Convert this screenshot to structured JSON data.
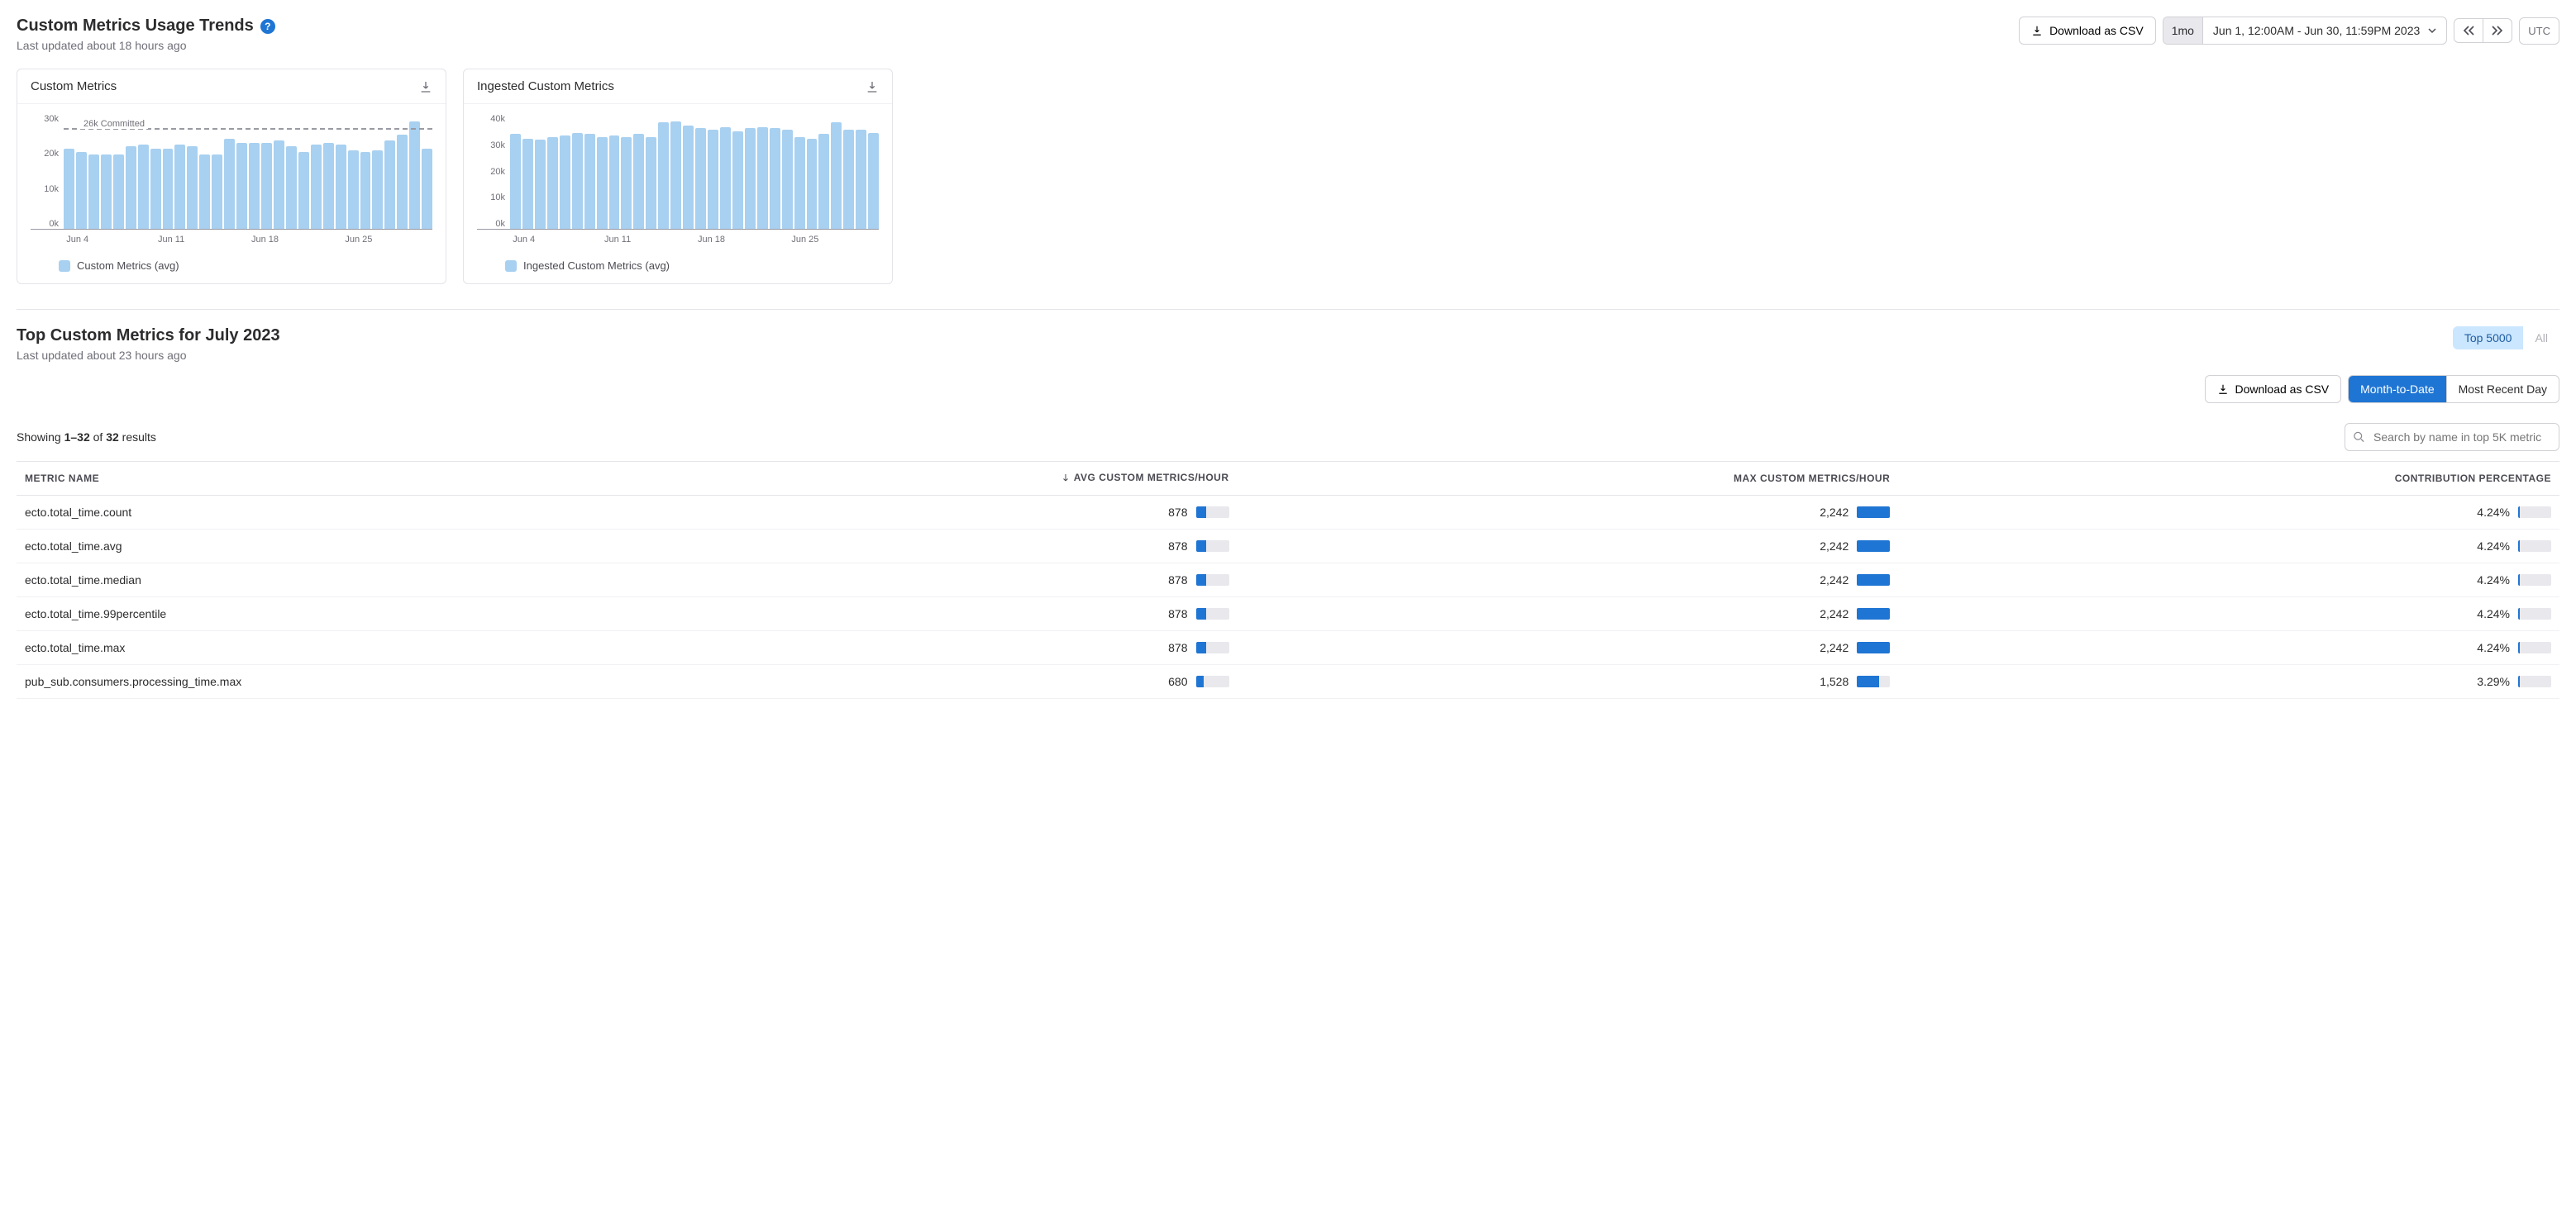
{
  "trends": {
    "title": "Custom Metrics Usage Trends",
    "subtitle": "Last updated about 18 hours ago",
    "download_csv": "Download as CSV",
    "range_chip": "1mo",
    "range_text": "Jun 1, 12:00AM - Jun 30, 11:59PM 2023",
    "tz": "UTC"
  },
  "chart_data": [
    {
      "type": "bar",
      "title": "Custom Metrics",
      "legend": "Custom Metrics (avg)",
      "ylim": [
        0,
        30000
      ],
      "yticks": [
        "0k",
        "10k",
        "20k",
        "30k"
      ],
      "annotation": "26k Committed",
      "annotation_value": 26000,
      "xticks": [
        "Jun 4",
        "Jun 11",
        "Jun 18",
        "Jun 25"
      ],
      "categories": [
        "Jun 1",
        "Jun 2",
        "Jun 3",
        "Jun 4",
        "Jun 5",
        "Jun 6",
        "Jun 7",
        "Jun 8",
        "Jun 9",
        "Jun 10",
        "Jun 11",
        "Jun 12",
        "Jun 13",
        "Jun 14",
        "Jun 15",
        "Jun 16",
        "Jun 17",
        "Jun 18",
        "Jun 19",
        "Jun 20",
        "Jun 21",
        "Jun 22",
        "Jun 23",
        "Jun 24",
        "Jun 25",
        "Jun 26",
        "Jun 27",
        "Jun 28",
        "Jun 29",
        "Jun 30"
      ],
      "values": [
        21000,
        20000,
        19500,
        19500,
        19500,
        21500,
        22000,
        21000,
        21000,
        22000,
        21500,
        19500,
        19500,
        23500,
        22500,
        22500,
        22500,
        23000,
        21500,
        20000,
        22000,
        22500,
        22000,
        20500,
        20000,
        20500,
        23000,
        24500,
        28000,
        21000
      ]
    },
    {
      "type": "bar",
      "title": "Ingested Custom Metrics",
      "legend": "Ingested Custom Metrics (avg)",
      "ylim": [
        0,
        40000
      ],
      "yticks": [
        "0k",
        "10k",
        "20k",
        "30k",
        "40k"
      ],
      "xticks": [
        "Jun 4",
        "Jun 11",
        "Jun 18",
        "Jun 25"
      ],
      "categories": [
        "Jun 1",
        "Jun 2",
        "Jun 3",
        "Jun 4",
        "Jun 5",
        "Jun 6",
        "Jun 7",
        "Jun 8",
        "Jun 9",
        "Jun 10",
        "Jun 11",
        "Jun 12",
        "Jun 13",
        "Jun 14",
        "Jun 15",
        "Jun 16",
        "Jun 17",
        "Jun 18",
        "Jun 19",
        "Jun 20",
        "Jun 21",
        "Jun 22",
        "Jun 23",
        "Jun 24",
        "Jun 25",
        "Jun 26",
        "Jun 27",
        "Jun 28",
        "Jun 29",
        "Jun 30"
      ],
      "values": [
        33000,
        31500,
        31000,
        32000,
        32500,
        33500,
        33000,
        32000,
        32500,
        32000,
        33000,
        32000,
        37000,
        37500,
        36000,
        35000,
        34500,
        35500,
        34000,
        35000,
        35500,
        35000,
        34500,
        32000,
        31500,
        33000,
        37000,
        34500,
        34500,
        33500
      ]
    }
  ],
  "top": {
    "title": "Top Custom Metrics for July 2023",
    "subtitle": "Last updated about 23 hours ago",
    "top5000": "Top 5000",
    "all": "All",
    "download_csv": "Download as CSV",
    "mtd": "Month-to-Date",
    "most_recent": "Most Recent Day",
    "showing_prefix": "Showing ",
    "showing_range": "1–32",
    "showing_mid": " of ",
    "showing_total": "32",
    "showing_suffix": " results",
    "search_placeholder": "Search by name in top 5K metric",
    "columns": {
      "name": "METRIC NAME",
      "avg": "AVG CUSTOM METRICS/HOUR",
      "max": "MAX CUSTOM METRICS/HOUR",
      "contrib": "CONTRIBUTION PERCENTAGE"
    },
    "rows": [
      {
        "name": "ecto.total_time.count",
        "avg": "878",
        "avg_pct": 30,
        "max": "2,242",
        "max_pct": 100,
        "contrib": "4.24%",
        "contrib_pct": 6
      },
      {
        "name": "ecto.total_time.avg",
        "avg": "878",
        "avg_pct": 30,
        "max": "2,242",
        "max_pct": 100,
        "contrib": "4.24%",
        "contrib_pct": 6
      },
      {
        "name": "ecto.total_time.median",
        "avg": "878",
        "avg_pct": 30,
        "max": "2,242",
        "max_pct": 100,
        "contrib": "4.24%",
        "contrib_pct": 6
      },
      {
        "name": "ecto.total_time.99percentile",
        "avg": "878",
        "avg_pct": 30,
        "max": "2,242",
        "max_pct": 100,
        "contrib": "4.24%",
        "contrib_pct": 6
      },
      {
        "name": "ecto.total_time.max",
        "avg": "878",
        "avg_pct": 30,
        "max": "2,242",
        "max_pct": 100,
        "contrib": "4.24%",
        "contrib_pct": 6
      },
      {
        "name": "pub_sub.consumers.processing_time.max",
        "avg": "680",
        "avg_pct": 23,
        "max": "1,528",
        "max_pct": 68,
        "contrib": "3.29%",
        "contrib_pct": 5
      }
    ]
  }
}
